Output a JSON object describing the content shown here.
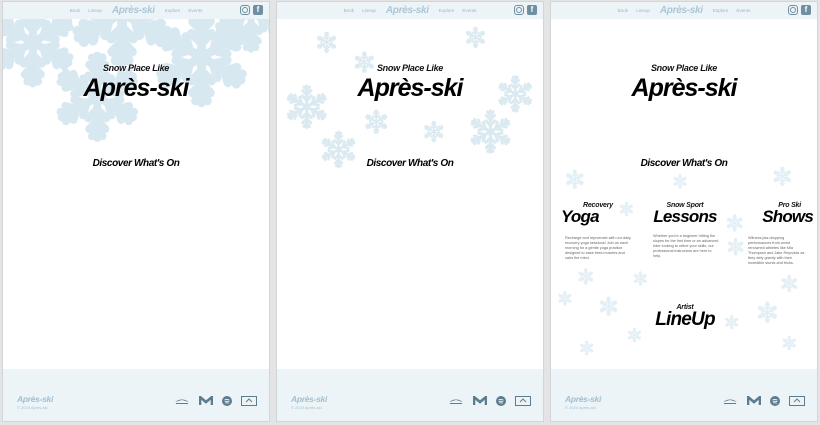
{
  "nav": {
    "links_left": [
      "Book",
      "Lineup"
    ],
    "logo": "Après-ski",
    "links_right": [
      "Explore",
      "Events"
    ],
    "icons": [
      "instagram-icon",
      "facebook-icon"
    ]
  },
  "hero": {
    "subtitle": "Snow Place Like",
    "title": "Après-ski"
  },
  "discover": "Discover What's On",
  "activities": [
    {
      "subtitle": "Recovery",
      "title": "Yoga",
      "description": "Recharge and rejuvenate with our daily recovery yoga sessions! Join us each morning for a gentle yoga practice designed to ease tired muscles and calm the mind."
    },
    {
      "subtitle": "Snow Sport",
      "title": "Lessons",
      "description": "Whether you're a beginner hitting the slopes for the first time or an advanced rider looking to refine your skills, our professional instructors are here to help."
    },
    {
      "subtitle": "Pro Ski",
      "title": "Shows",
      "description": "Witness jaw-dropping performances from world renowned athletes like Mia Thompson and Jake Reynolds as they defy gravity with their incredible stunts and tricks."
    },
    {
      "subtitle": "Artist",
      "title": "LineUp",
      "description": ""
    }
  ],
  "footer": {
    "logo": "Après-ski",
    "copyright": "© 2024 Après-ski",
    "sponsors": [
      "sponsor-bird-logo",
      "sponsor-m-logo",
      "spotify-icon",
      "sponsor-badge-logo"
    ]
  },
  "colors": {
    "nav_bg": "#ecf4f8",
    "snowflake": "#dbe9f1",
    "logo": "#a9c7d8",
    "text": "#000000"
  }
}
